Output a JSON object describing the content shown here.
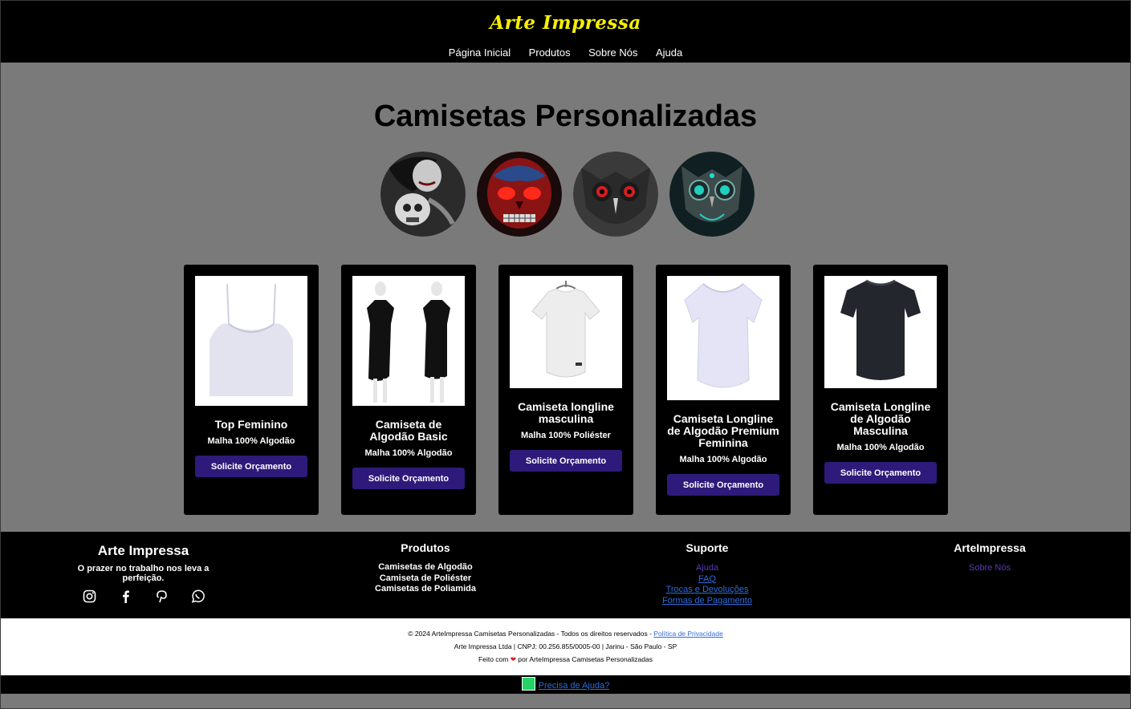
{
  "header": {
    "logo": "Arte Impressa",
    "nav": [
      "Página Inicial",
      "Produtos",
      "Sobre Nós",
      "Ajuda"
    ]
  },
  "main": {
    "title": "Camisetas Personalizadas",
    "gallery": [
      "woman-skull-art",
      "red-skull-art",
      "dark-owl-art",
      "teal-owl-art"
    ],
    "products": [
      {
        "title": "Top Feminino",
        "desc": "Malha 100% Algodão",
        "button": "Solicite Orçamento"
      },
      {
        "title": "Camiseta de Algodão Basic",
        "desc": "Malha 100% Algodão",
        "button": "Solicite Orçamento"
      },
      {
        "title": "Camiseta longline masculina",
        "desc": "Malha 100% Poliéster",
        "button": "Solicite Orçamento"
      },
      {
        "title": "Camiseta Longline de Algodão Premium Feminina",
        "desc": "Malha 100% Algodão",
        "button": "Solicite Orçamento"
      },
      {
        "title": "Camiseta Longline de Algodão Masculina",
        "desc": "Malha 100% Algodão",
        "button": "Solicite Orçamento"
      }
    ]
  },
  "footer": {
    "brand": "Arte Impressa",
    "tagline": "O prazer no trabalho nos leva a perfeição.",
    "socials": [
      "instagram-icon",
      "facebook-icon",
      "pinterest-icon",
      "whatsapp-icon"
    ],
    "products_title": "Produtos",
    "products_links": [
      "Camisetas de Algodão",
      "Camiseta de Poliéster",
      "Camisetas de Poliamida"
    ],
    "support_title": "Suporte",
    "support_links": [
      "Ajuda",
      "FAQ",
      "Trocas e Devoluções",
      "Formas de Pagamento"
    ],
    "about_title": "ArteImpressa",
    "about_links": [
      "Sobre Nós"
    ]
  },
  "copyright": {
    "line1": "© 2024 ArteImpressa Camisetas Personalizadas - Todos os direitos reservados -",
    "privacy": "Política de Privacidade",
    "line2": "Arte Impressa Ltda | CNPJ: 00.256.855/0005-00 | Jarinu - São Paulo - SP",
    "made_prefix": "Feito com",
    "made_suffix": "por ArteImpressa Camisetas Personalizadas"
  },
  "help": {
    "label": "Precisa de Ajuda?"
  },
  "colors": {
    "logo": "#f5f000",
    "button": "#2e1a7a",
    "link": "#2f6ddc",
    "background": "#7a7a7a"
  }
}
